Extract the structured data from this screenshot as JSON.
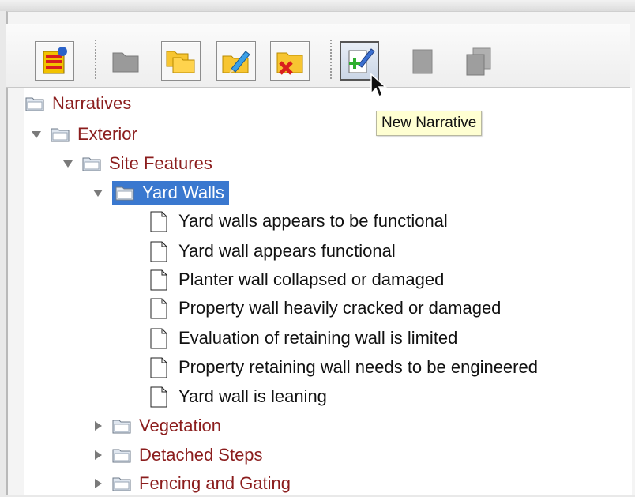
{
  "toolbar": {
    "buttons": [
      {
        "icon": "database-icon",
        "enabled": true
      },
      {
        "icon": "folder-icon",
        "enabled": false
      },
      {
        "icon": "open-folders-icon",
        "enabled": true
      },
      {
        "icon": "edit-folder-icon",
        "enabled": true
      },
      {
        "icon": "delete-folder-icon",
        "enabled": true
      },
      {
        "icon": "new-narrative-icon",
        "enabled": true
      },
      {
        "icon": "narrative-icon",
        "enabled": false
      },
      {
        "icon": "copy-narrative-icon",
        "enabled": false
      }
    ]
  },
  "tooltip": {
    "text": "New Narrative"
  },
  "tree": {
    "root": "Narratives",
    "exterior": "Exterior",
    "site_features": "Site Features",
    "yard_walls": "Yard Walls",
    "narratives": [
      "Yard walls appears to be functional",
      "Yard wall appears functional",
      "Planter wall collapsed or damaged",
      "Property wall heavily cracked or damaged",
      "Evaluation of retaining wall is limited",
      "Property retaining wall needs to be engineered",
      "Yard wall is leaning"
    ],
    "siblings": [
      "Vegetation",
      "Detached Steps",
      "Fencing and Gating"
    ]
  }
}
